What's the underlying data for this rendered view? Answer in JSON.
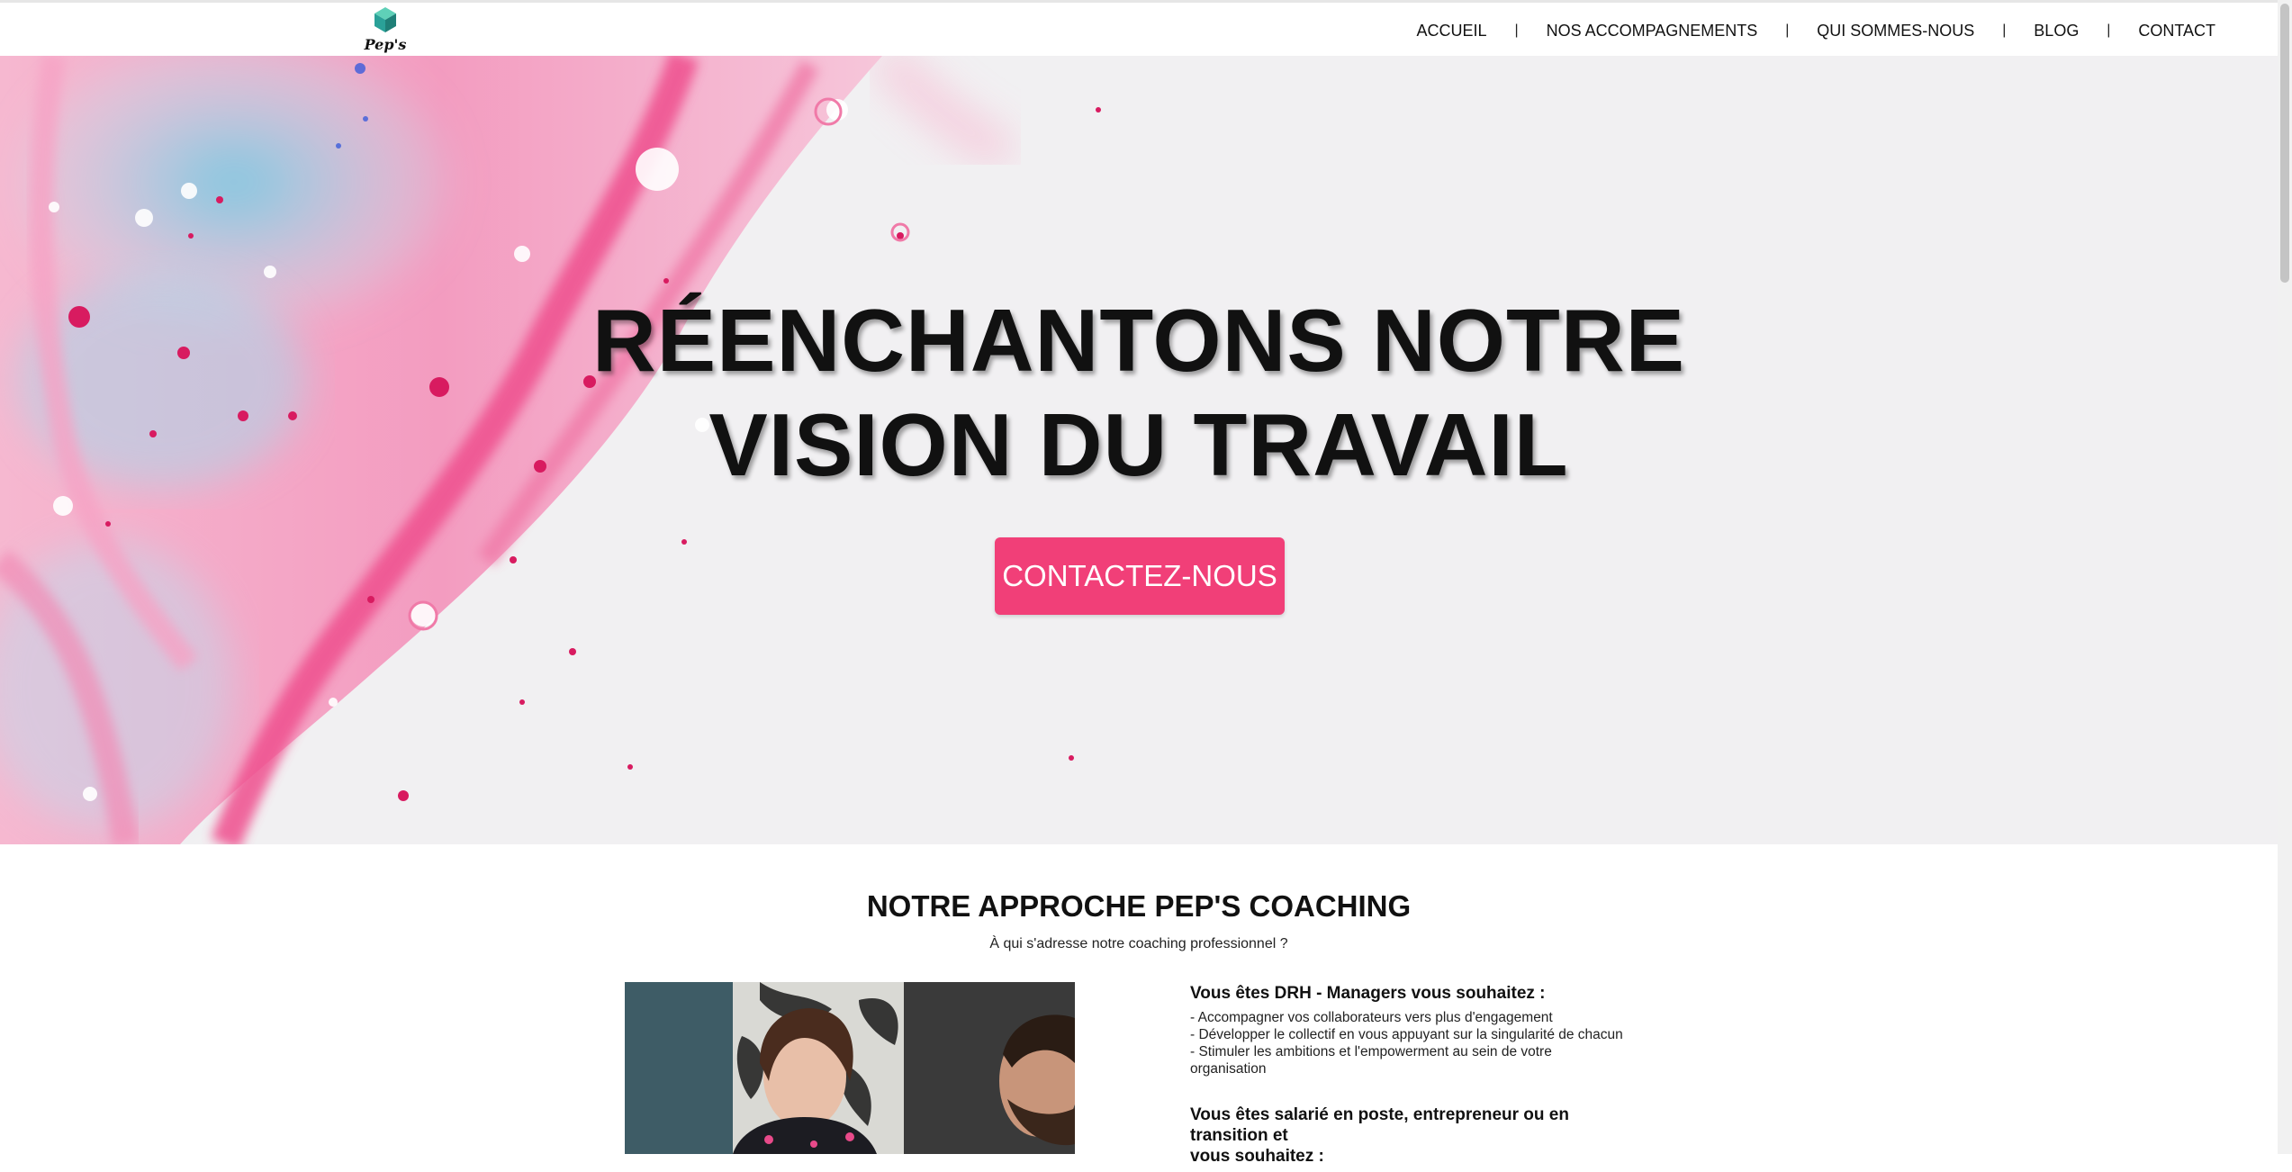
{
  "brand": {
    "logo_text": "Pep's",
    "logo_accent": "#2aa198"
  },
  "nav": {
    "items": [
      {
        "label": "ACCUEIL"
      },
      {
        "label": "NOS ACCOMPAGNEMENTS"
      },
      {
        "label": "QUI SOMMES-NOUS"
      },
      {
        "label": "BLOG"
      },
      {
        "label": "CONTACT"
      }
    ],
    "separator": "|"
  },
  "hero": {
    "title_line1": "RÉENCHANTONS NOTRE",
    "title_line2": "VISION DU TRAVAIL",
    "cta_label": "CONTACTEZ-NOUS",
    "cta_color": "#f13f78",
    "palette": {
      "pink": "#f48fb7",
      "hot_pink": "#e8327a",
      "blue": "#9fd3e6",
      "grey": "#f1f0f2"
    }
  },
  "approach": {
    "title": "NOTRE APPROCHE PEP'S COACHING",
    "subtitle": "À qui s'adresse notre coaching professionnel ?",
    "blocks": [
      {
        "heading": "Vous êtes DRH - Managers vous souhaitez :",
        "lines": [
          "- Accompagner vos collaborateurs vers plus d'engagement",
          "- Développer le collectif en vous appuyant sur la singularité de chacun",
          "- Stimuler les ambitions et l'empowerment au sein de votre",
          "organisation"
        ]
      },
      {
        "heading_line1": "Vous êtes salarié en poste, entrepreneur ou en transition et",
        "heading_line2": "vous souhaitez :"
      }
    ]
  }
}
